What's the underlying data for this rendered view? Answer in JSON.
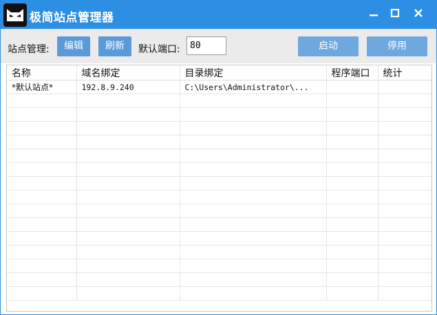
{
  "window": {
    "title": "极简站点管理器",
    "minimize": "–",
    "maximize": "□",
    "close": "✕"
  },
  "toolbar": {
    "site_manage_label": "站点管理:",
    "edit_button": "编辑",
    "refresh_button": "刷新",
    "default_port_label": "默认端口:",
    "default_port_value": "80",
    "start_button": "启动",
    "stop_button": "停用"
  },
  "table": {
    "columns": [
      "名称",
      "域名绑定",
      "目录绑定",
      "程序端口",
      "统计"
    ],
    "rows": [
      [
        "*默认站点*",
        "192.8.9.240",
        "C:\\Users\\Administrator\\...",
        "",
        ""
      ]
    ]
  },
  "colors": {
    "titlebar": "#2c8fe3",
    "button": "#5a9ad8",
    "toolbar_bg": "#ebebeb"
  }
}
